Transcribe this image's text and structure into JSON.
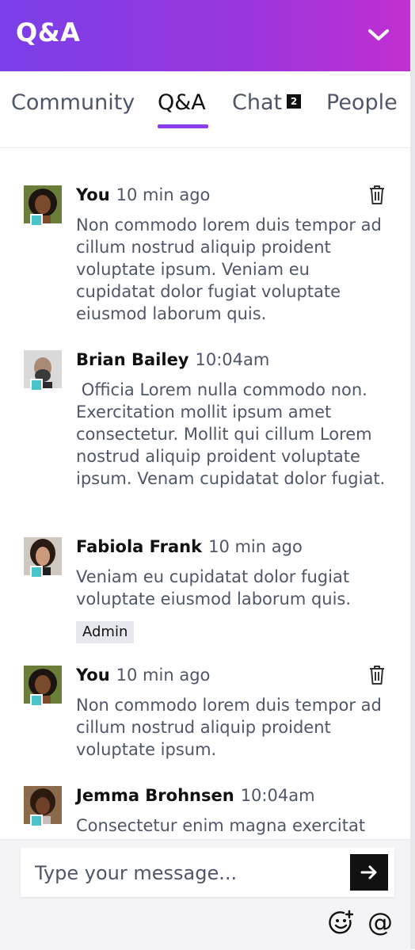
{
  "header": {
    "title": "Q&A",
    "collapse_icon": "chevron-down-icon"
  },
  "tabs": [
    {
      "label": "Community",
      "active": false
    },
    {
      "label": "Q&A",
      "active": true
    },
    {
      "label": "Chat",
      "active": false,
      "badge": "2"
    },
    {
      "label": "People",
      "active": false
    }
  ],
  "messages": [
    {
      "author": "You",
      "time": "10 min ago",
      "text": "Non commodo lorem duis tempor ad cillum nostrud aliquip proident voluptate ipsum. Veniam eu cupidatat dolor fugiat voluptate eiusmod laborum quis.",
      "deletable": true
    },
    {
      "author": "Brian Bailey",
      "time": "10:04am",
      "text": " Officia Lorem nulla commodo non. Exercitation mollit ipsum amet consectetur. Mollit qui cillum Lorem nostrud aliquip proident voluptate ipsum. Venam cupidatat dolor fugiat.",
      "deletable": false
    },
    {
      "author": "Fabiola Frank",
      "time": "10 min ago",
      "text": "Veniam eu cupidatat dolor fugiat voluptate eiusmod laborum quis.",
      "badge": "Admin",
      "deletable": false
    },
    {
      "author": "You",
      "time": "10 min ago",
      "text": "Non commodo lorem duis tempor ad cillum nostrud aliquip proident voluptate ipsum.",
      "deletable": true
    },
    {
      "author": "Jemma Brohnsen",
      "time": "10:04am",
      "text": "Consectetur enim magna exercitat officia ullamco nostrud.",
      "deletable": false
    }
  ],
  "composer": {
    "placeholder": "Type your message...",
    "value": "",
    "send_icon": "arrow-right-icon",
    "emoji_icon": "emoji-add-icon",
    "mention_icon": "at-sign-icon",
    "mention_glyph": "@"
  },
  "colors": {
    "accent": "#8a3ef0",
    "header_start": "#7a3fe8",
    "header_end": "#c12fd0",
    "presence": "#49c3c8"
  }
}
